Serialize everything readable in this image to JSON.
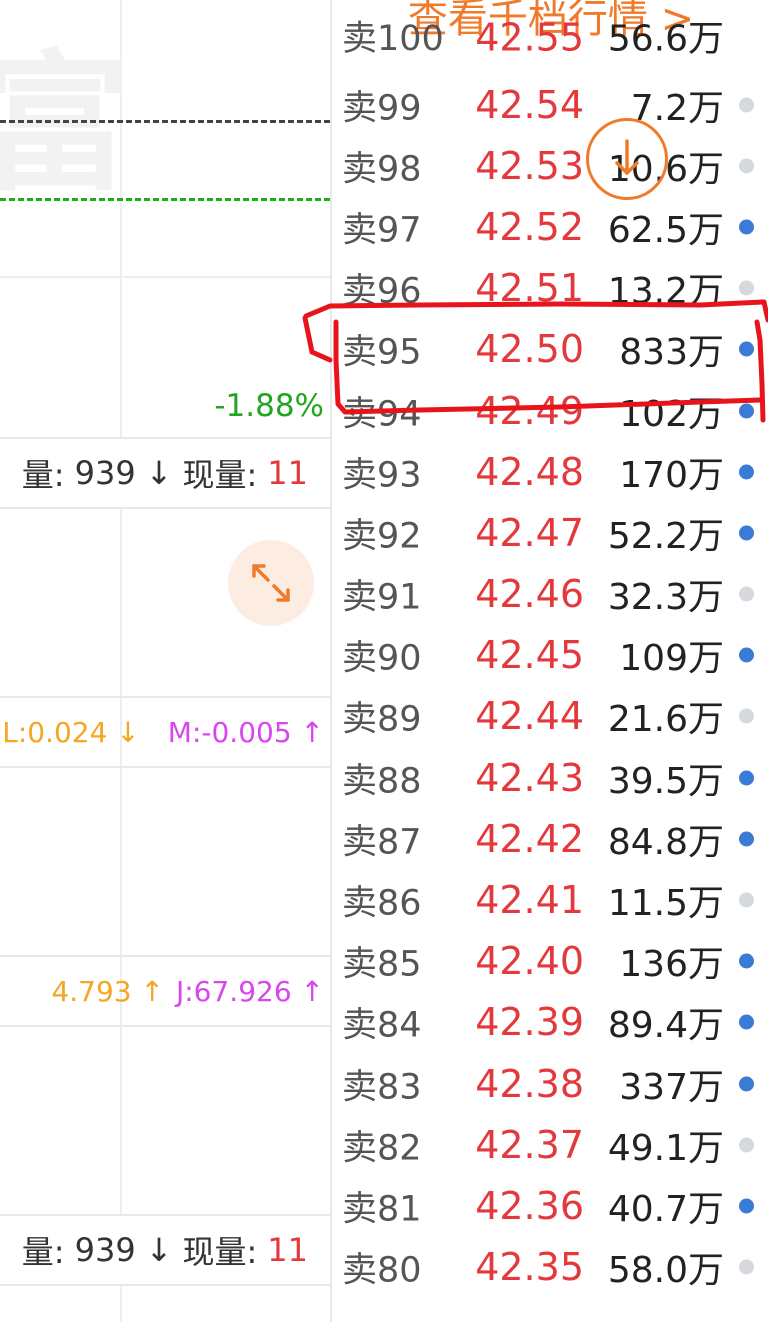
{
  "left": {
    "watermark": "富",
    "change_pct": "-1.88%",
    "volume_bar": {
      "label_total": "量:",
      "total": "939",
      "arrow": "↓",
      "label_now": "现量:",
      "now": "11"
    },
    "macd_bar": {
      "first": "L:0.024 ↓",
      "second": "M:-0.005 ↑"
    },
    "kdj_bar": {
      "first": "4.793 ↑",
      "second": "J:67.926 ↑"
    },
    "volume_bar_2": {
      "label_total": "量:",
      "total": "939",
      "arrow": "↓",
      "label_now": "现量:",
      "now": "11"
    }
  },
  "right": {
    "view_link": "查看千档行情 >",
    "top_partial": {
      "label": "卖100",
      "price": "42.55",
      "volume": "56.6万"
    },
    "rows": [
      {
        "label": "卖99",
        "price": "42.54",
        "volume": "7.2万",
        "dot": "gray"
      },
      {
        "label": "卖98",
        "price": "42.53",
        "volume": "10.6万",
        "dot": "gray"
      },
      {
        "label": "卖97",
        "price": "42.52",
        "volume": "62.5万",
        "dot": "blue"
      },
      {
        "label": "卖96",
        "price": "42.51",
        "volume": "13.2万",
        "dot": "gray"
      },
      {
        "label": "卖95",
        "price": "42.50",
        "volume": "833万",
        "dot": "blue"
      },
      {
        "label": "卖94",
        "price": "42.49",
        "volume": "102万",
        "dot": "blue"
      },
      {
        "label": "卖93",
        "price": "42.48",
        "volume": "170万",
        "dot": "blue"
      },
      {
        "label": "卖92",
        "price": "42.47",
        "volume": "52.2万",
        "dot": "blue"
      },
      {
        "label": "卖91",
        "price": "42.46",
        "volume": "32.3万",
        "dot": "gray"
      },
      {
        "label": "卖90",
        "price": "42.45",
        "volume": "109万",
        "dot": "blue"
      },
      {
        "label": "卖89",
        "price": "42.44",
        "volume": "21.6万",
        "dot": "gray"
      },
      {
        "label": "卖88",
        "price": "42.43",
        "volume": "39.5万",
        "dot": "blue"
      },
      {
        "label": "卖87",
        "price": "42.42",
        "volume": "84.8万",
        "dot": "blue"
      },
      {
        "label": "卖86",
        "price": "42.41",
        "volume": "11.5万",
        "dot": "gray"
      },
      {
        "label": "卖85",
        "price": "42.40",
        "volume": "136万",
        "dot": "blue"
      },
      {
        "label": "卖84",
        "price": "42.39",
        "volume": "89.4万",
        "dot": "blue"
      },
      {
        "label": "卖83",
        "price": "42.38",
        "volume": "337万",
        "dot": "blue"
      },
      {
        "label": "卖82",
        "price": "42.37",
        "volume": "49.1万",
        "dot": "gray"
      },
      {
        "label": "卖81",
        "price": "42.36",
        "volume": "40.7万",
        "dot": "blue"
      },
      {
        "label": "卖80",
        "price": "42.35",
        "volume": "58.0万",
        "dot": "gray"
      }
    ]
  },
  "colors": {
    "up": "#e4393c",
    "down": "#23a523",
    "accent": "#f07a2a",
    "dot_active": "#3a7bd5",
    "dot_idle": "#d5d8dc"
  }
}
